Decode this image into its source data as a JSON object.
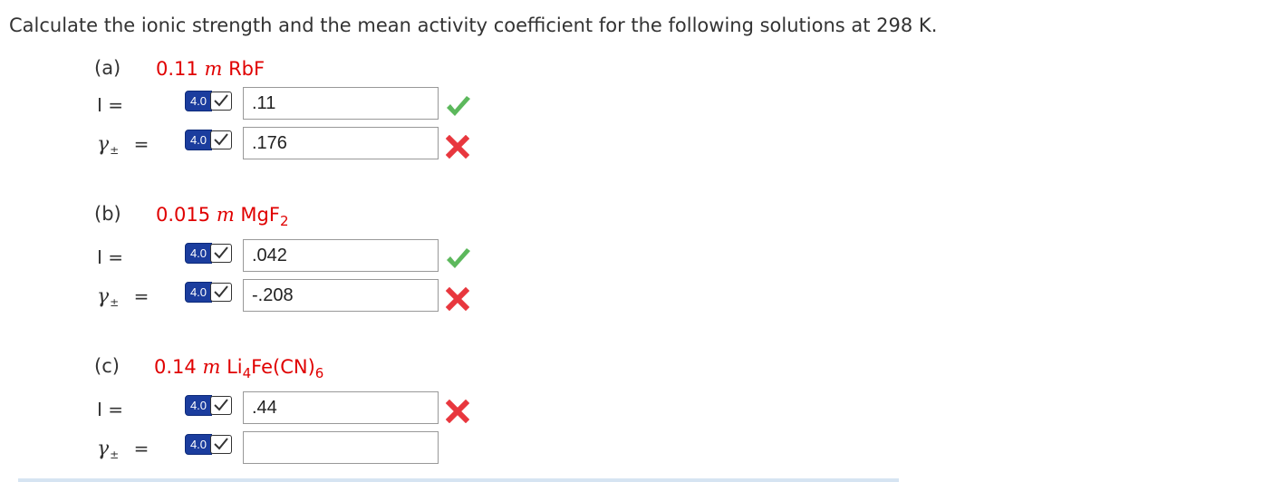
{
  "question": "Calculate the ionic strength and the mean activity coefficient for the following solutions at 298 K.",
  "badge_value": "4.0",
  "parts": [
    {
      "label": "(a)",
      "amount": "0.11",
      "unit": "m",
      "formula_pre": "RbF",
      "formula_sub1": "",
      "formula_mid": "",
      "formula_sub2": "",
      "ionic_label": "I =",
      "gamma_label": "γ",
      "gamma_sub": "±",
      "gamma_eq": "=",
      "ionic_answer": ".11",
      "ionic_status": "correct",
      "gamma_answer": ".176",
      "gamma_status": "incorrect"
    },
    {
      "label": "(b)",
      "amount": "0.015",
      "unit": "m",
      "formula_pre": "MgF",
      "formula_sub1": "2",
      "formula_mid": "",
      "formula_sub2": "",
      "ionic_label": "I =",
      "gamma_label": "γ",
      "gamma_sub": "±",
      "gamma_eq": "=",
      "ionic_answer": ".042",
      "ionic_status": "correct",
      "gamma_answer": "-.208",
      "gamma_status": "incorrect"
    },
    {
      "label": "(c)",
      "amount": "0.14",
      "unit": "m",
      "formula_pre": "Li",
      "formula_sub1": "4",
      "formula_mid": "Fe(CN)",
      "formula_sub2": "6",
      "ionic_label": "I =",
      "gamma_label": "γ",
      "gamma_sub": "±",
      "gamma_eq": "=",
      "ionic_answer": ".44",
      "ionic_status": "incorrect",
      "gamma_answer": "",
      "gamma_status": "none"
    }
  ],
  "colors": {
    "correct": "#5cb85c",
    "incorrect": "#e8373e",
    "compound": "#e00000",
    "badge": "#1b3d9e"
  },
  "icons": {
    "correct": "green-check-icon",
    "incorrect": "red-x-icon",
    "badge_check": "checkbox-check-icon"
  }
}
